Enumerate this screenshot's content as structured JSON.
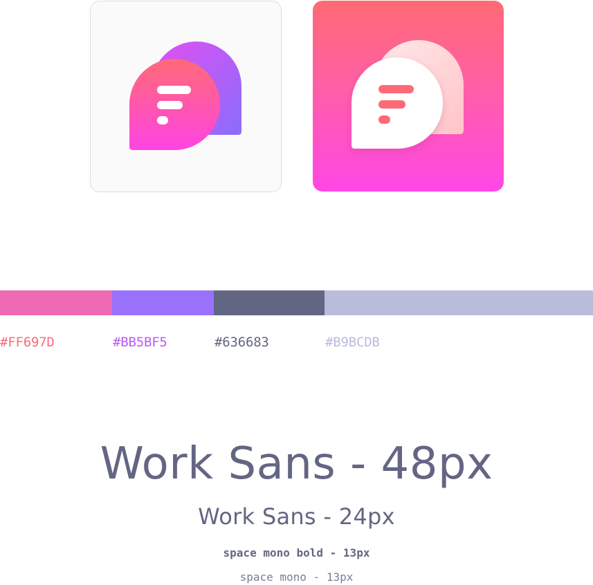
{
  "icons": [
    {
      "name": "light",
      "background": "#FAFAFA",
      "border": "#DCDCEA"
    },
    {
      "name": "gradient",
      "background_top": "#FF6A74",
      "background_bottom": "#FF47E6"
    }
  ],
  "palette": [
    {
      "hex_label": "#FF697D",
      "bar_color": "#EE6AB2",
      "label_color": "#FF697D"
    },
    {
      "hex_label": "#BB5BF5",
      "bar_color": "#9A71FC",
      "label_color": "#BB5BF5"
    },
    {
      "hex_label": "#636683",
      "bar_color": "#636683",
      "label_color": "#636683"
    },
    {
      "hex_label": "#B9BCDB",
      "bar_color": "#B9BCDB",
      "label_color": "#B9BCDB"
    }
  ],
  "typography": {
    "display": "Work Sans - 48px",
    "heading": "Work Sans - 24px",
    "mono_bold": "space mono bold - 13px",
    "mono_regular": "space mono - 13px"
  }
}
